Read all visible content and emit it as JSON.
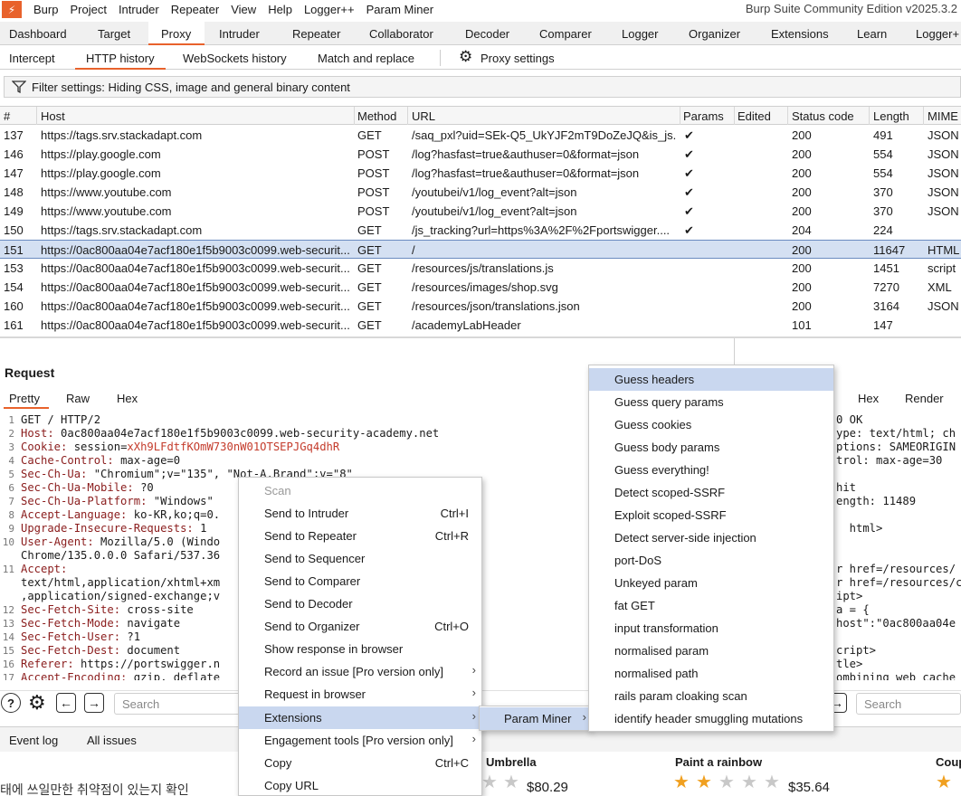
{
  "app": {
    "menu": [
      "Burp",
      "Project",
      "Intruder",
      "Repeater",
      "View",
      "Help",
      "Logger++",
      "Param Miner"
    ],
    "title": "Burp Suite Community Edition v2025.3.2"
  },
  "main_tabs": [
    "Dashboard",
    "Target",
    "Proxy",
    "Intruder",
    "Repeater",
    "Collaborator",
    "Decoder",
    "Comparer",
    "Logger",
    "Organizer",
    "Extensions",
    "Learn",
    "Logger+"
  ],
  "main_tab_active": "Proxy",
  "proxy_tabs": [
    "Intercept",
    "HTTP history",
    "WebSockets history",
    "Match and replace",
    "Proxy settings"
  ],
  "proxy_tab_active": "HTTP history",
  "filter_text": "Filter settings: Hiding CSS, image and general binary content",
  "table": {
    "columns": [
      "#",
      "Host",
      "Method",
      "URL",
      "Params",
      "Edited",
      "Status code",
      "Length",
      "MIME"
    ],
    "rows": [
      {
        "num": "137",
        "host": "https://tags.srv.stackadapt.com",
        "method": "GET",
        "url": "/saq_pxl?uid=SEk-Q5_UkYJF2mT9DoZeJQ&is_js...",
        "params": true,
        "status": "200",
        "length": "491",
        "mime": "JSON"
      },
      {
        "num": "146",
        "host": "https://play.google.com",
        "method": "POST",
        "url": "/log?hasfast=true&authuser=0&format=json",
        "params": true,
        "status": "200",
        "length": "554",
        "mime": "JSON"
      },
      {
        "num": "147",
        "host": "https://play.google.com",
        "method": "POST",
        "url": "/log?hasfast=true&authuser=0&format=json",
        "params": true,
        "status": "200",
        "length": "554",
        "mime": "JSON"
      },
      {
        "num": "148",
        "host": "https://www.youtube.com",
        "method": "POST",
        "url": "/youtubei/v1/log_event?alt=json",
        "params": true,
        "status": "200",
        "length": "370",
        "mime": "JSON"
      },
      {
        "num": "149",
        "host": "https://www.youtube.com",
        "method": "POST",
        "url": "/youtubei/v1/log_event?alt=json",
        "params": true,
        "status": "200",
        "length": "370",
        "mime": "JSON"
      },
      {
        "num": "150",
        "host": "https://tags.srv.stackadapt.com",
        "method": "GET",
        "url": "/js_tracking?url=https%3A%2F%2Fportswigger....",
        "params": true,
        "status": "204",
        "length": "224",
        "mime": ""
      },
      {
        "num": "151",
        "host": "https://0ac800aa04e7acf180e1f5b9003c0099.web-securit...",
        "method": "GET",
        "url": "/",
        "params": false,
        "status": "200",
        "length": "11647",
        "mime": "HTML",
        "selected": true
      },
      {
        "num": "153",
        "host": "https://0ac800aa04e7acf180e1f5b9003c0099.web-securit...",
        "method": "GET",
        "url": "/resources/js/translations.js",
        "params": false,
        "status": "200",
        "length": "1451",
        "mime": "script"
      },
      {
        "num": "154",
        "host": "https://0ac800aa04e7acf180e1f5b9003c0099.web-securit...",
        "method": "GET",
        "url": "/resources/images/shop.svg",
        "params": false,
        "status": "200",
        "length": "7270",
        "mime": "XML"
      },
      {
        "num": "160",
        "host": "https://0ac800aa04e7acf180e1f5b9003c0099.web-securit...",
        "method": "GET",
        "url": "/resources/json/translations.json",
        "params": false,
        "status": "200",
        "length": "3164",
        "mime": "JSON"
      },
      {
        "num": "161",
        "host": "https://0ac800aa04e7acf180e1f5b9003c0099.web-securit...",
        "method": "GET",
        "url": "/academyLabHeader",
        "params": false,
        "status": "101",
        "length": "147",
        "mime": ""
      }
    ]
  },
  "request": {
    "title": "Request",
    "tabs": [
      "Pretty",
      "Raw",
      "Hex"
    ],
    "lines": [
      {
        "n": "1",
        "k": "",
        "v": "GET / HTTP/2"
      },
      {
        "n": "2",
        "k": "Host:",
        "v": " 0ac800aa04e7acf180e1f5b9003c0099.web-security-academy.net"
      },
      {
        "n": "3",
        "k": "Cookie:",
        "v": " session=",
        "cv": "xXh9LFdtfKOmW730nW01OTSEPJGq4dhR"
      },
      {
        "n": "4",
        "k": "Cache-Control:",
        "v": " max-age=0"
      },
      {
        "n": "5",
        "k": "Sec-Ch-Ua:",
        "v": " \"Chromium\";v=\"135\", \"Not-A.Brand\";v=\"8\""
      },
      {
        "n": "6",
        "k": "Sec-Ch-Ua-Mobile:",
        "v": " ?0"
      },
      {
        "n": "7",
        "k": "Sec-Ch-Ua-Platform:",
        "v": " \"Windows\""
      },
      {
        "n": "8",
        "k": "Accept-Language:",
        "v": " ko-KR,ko;q=0."
      },
      {
        "n": "9",
        "k": "Upgrade-Insecure-Requests:",
        "v": " 1"
      },
      {
        "n": "10",
        "k": "User-Agent:",
        "v": " Mozilla/5.0 (Windo                    t/537.36 (KHTML"
      },
      {
        "n": "",
        "k": "",
        "v": "Chrome/135.0.0.0 Safari/537.36"
      },
      {
        "n": "11",
        "k": "Accept:",
        "v": ""
      },
      {
        "n": "",
        "k": "",
        "v": "text/html,application/xhtml+xm                  ,image/webp,ima"
      },
      {
        "n": "",
        "k": "",
        "v": ",application/signed-exchange;v"
      },
      {
        "n": "12",
        "k": "Sec-Fetch-Site:",
        "v": " cross-site"
      },
      {
        "n": "13",
        "k": "Sec-Fetch-Mode:",
        "v": " navigate"
      },
      {
        "n": "14",
        "k": "Sec-Fetch-User:",
        "v": " ?1"
      },
      {
        "n": "15",
        "k": "Sec-Fetch-Dest:",
        "v": " document"
      },
      {
        "n": "16",
        "k": "Referer:",
        "v": " https://portswigger.n"
      },
      {
        "n": "17",
        "k": "Accept-Encoding:",
        "v": " gzip, deflate"
      }
    ]
  },
  "response": {
    "tabs": [
      "Hex",
      "Render"
    ],
    "lines": [
      "0 OK",
      "ype: text/html; ch",
      "ptions: SAMEORIGIN",
      "trol: max-age=30",
      "",
      "hit",
      "ength: 11489",
      "",
      "  html>",
      "",
      "",
      "r href=/resources/",
      "r href=/resources/c",
      "ipt>",
      "a = {",
      "host\":\"0ac800aa04e",
      "",
      "cript>",
      "tle>",
      "ombining web cache"
    ]
  },
  "bottom": {
    "search_placeholder": "Search",
    "search_placeholder_right": "Search"
  },
  "status_bar": {
    "event_log": "Event log",
    "all_issues": "All issues"
  },
  "webpage": {
    "korean_text": "태에 쓰일만한 취약점이 있는지 확인",
    "products": [
      {
        "name": "Umbrella",
        "price": "$80.29",
        "rating": 0
      },
      {
        "name": "Paint a rainbow",
        "price": "$35.64",
        "rating": 2
      },
      {
        "name": "Coup",
        "price": "",
        "rating": 1
      }
    ]
  },
  "context_menu": {
    "items": [
      {
        "label": "Scan",
        "disabled": true
      },
      {
        "label": "Send to Intruder",
        "shortcut": "Ctrl+I"
      },
      {
        "label": "Send to Repeater",
        "shortcut": "Ctrl+R"
      },
      {
        "label": "Send to Sequencer"
      },
      {
        "label": "Send to Comparer"
      },
      {
        "label": "Send to Decoder"
      },
      {
        "label": "Send to Organizer",
        "shortcut": "Ctrl+O"
      },
      {
        "label": "Show response in browser"
      },
      {
        "label": "Record an issue [Pro version only]",
        "submenu": true
      },
      {
        "label": "Request in browser",
        "submenu": true
      },
      {
        "label": "Extensions",
        "submenu": true,
        "highlighted": true
      },
      {
        "label": "Engagement tools [Pro version only]",
        "submenu": true
      },
      {
        "label": "Copy",
        "shortcut": "Ctrl+C"
      },
      {
        "label": "Copy URL"
      }
    ]
  },
  "extensions_submenu": {
    "label": "Param Miner"
  },
  "param_miner_menu": {
    "items": [
      "Guess headers",
      "Guess query params",
      "Guess cookies",
      "Guess body params",
      "Guess everything!",
      "Detect scoped-SSRF",
      "Exploit scoped-SSRF",
      "Detect server-side injection",
      "port-DoS",
      "Unkeyed param",
      "fat GET",
      "input transformation",
      "normalised param",
      "normalised path",
      "rails param cloaking scan",
      "identify header smuggling mutations"
    ],
    "highlighted_index": 0
  }
}
